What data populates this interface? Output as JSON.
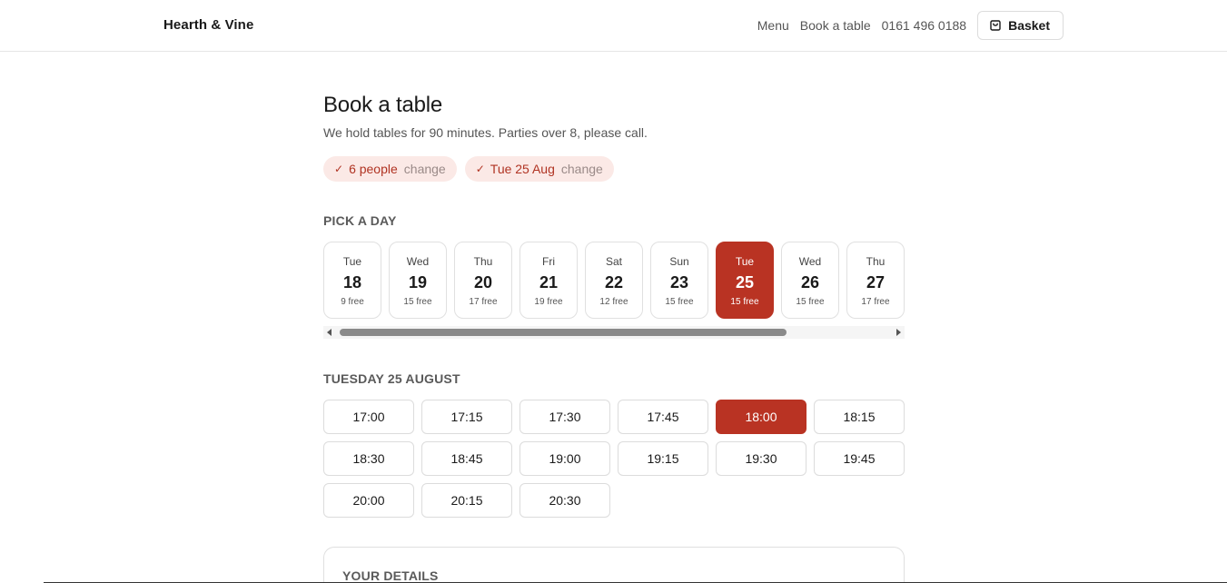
{
  "header": {
    "brand": "Hearth & Vine",
    "nav": {
      "menu": "Menu",
      "book": "Book a table",
      "phone": "0161 496 0188",
      "basket": "Basket"
    }
  },
  "page": {
    "title": "Book a table",
    "subtitle": "We hold tables for 90 minutes. Parties over 8, please call."
  },
  "chips": [
    {
      "check": "✓",
      "value": "6 people",
      "action": "change"
    },
    {
      "check": "✓",
      "value": "Tue 25 Aug",
      "action": "change"
    }
  ],
  "day_section": {
    "label": "PICK A DAY",
    "days": [
      {
        "dow": "Tue",
        "num": "18",
        "free": "9 free"
      },
      {
        "dow": "Wed",
        "num": "19",
        "free": "15 free"
      },
      {
        "dow": "Thu",
        "num": "20",
        "free": "17 free"
      },
      {
        "dow": "Fri",
        "num": "21",
        "free": "19 free"
      },
      {
        "dow": "Sat",
        "num": "22",
        "free": "12 free"
      },
      {
        "dow": "Sun",
        "num": "23",
        "free": "15 free"
      },
      {
        "dow": "Tue",
        "num": "25",
        "free": "15 free"
      },
      {
        "dow": "Wed",
        "num": "26",
        "free": "15 free"
      },
      {
        "dow": "Thu",
        "num": "27",
        "free": "17 free"
      }
    ],
    "selected_index": 6
  },
  "time_section": {
    "label": "TUESDAY 25 AUGUST",
    "times": [
      "17:00",
      "17:15",
      "17:30",
      "17:45",
      "18:00",
      "18:15",
      "18:30",
      "18:45",
      "19:00",
      "19:15",
      "19:30",
      "19:45",
      "20:00",
      "20:15",
      "20:30"
    ],
    "selected_index": 4
  },
  "details_section": {
    "label": "YOUR DETAILS"
  },
  "colors": {
    "accent": "#b93323",
    "chip_bg": "#fbe9e6",
    "chip_text": "#b03322"
  },
  "icons": {
    "basket": "shopping-bag-icon",
    "check": "check-icon",
    "scroll_left": "arrow-left-icon",
    "scroll_right": "arrow-right-icon"
  }
}
